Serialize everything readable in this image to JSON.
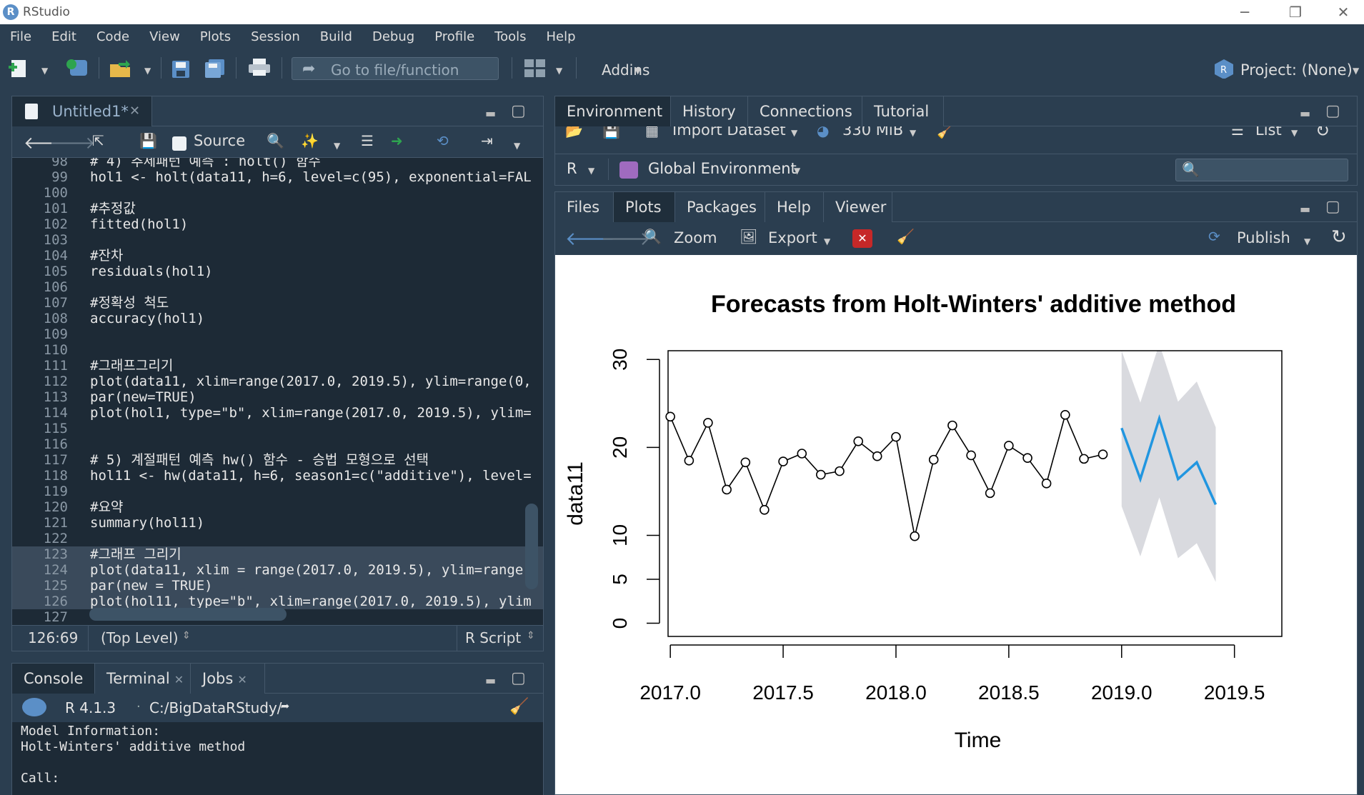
{
  "window": {
    "title": "RStudio"
  },
  "menu": [
    "File",
    "Edit",
    "Code",
    "View",
    "Plots",
    "Session",
    "Build",
    "Debug",
    "Profile",
    "Tools",
    "Help"
  ],
  "toolbar": {
    "goto_placeholder": "Go to file/function",
    "addins": "Addins",
    "project": "Project: (None)"
  },
  "editor": {
    "tab_label": "Untitled1*",
    "source_label": "Source",
    "lines": [
      {
        "n": "98",
        "t": "# 4) 추세패턴 예측 : holt() 함수"
      },
      {
        "n": "99",
        "t": "hol1 <- holt(data11, h=6, level=c(95), exponential=FAL"
      },
      {
        "n": "100",
        "t": ""
      },
      {
        "n": "101",
        "t": "#추정값"
      },
      {
        "n": "102",
        "t": "fitted(hol1)"
      },
      {
        "n": "103",
        "t": ""
      },
      {
        "n": "104",
        "t": "#잔차"
      },
      {
        "n": "105",
        "t": "residuals(hol1)"
      },
      {
        "n": "106",
        "t": ""
      },
      {
        "n": "107",
        "t": "#정확성 척도"
      },
      {
        "n": "108",
        "t": "accuracy(hol1)"
      },
      {
        "n": "109",
        "t": ""
      },
      {
        "n": "110",
        "t": ""
      },
      {
        "n": "111",
        "t": "#그래프그리기"
      },
      {
        "n": "112",
        "t": "plot(data11, xlim=range(2017.0, 2019.5), ylim=range(0,"
      },
      {
        "n": "113",
        "t": "par(new=TRUE)"
      },
      {
        "n": "114",
        "t": "plot(hol1, type=\"b\", xlim=range(2017.0, 2019.5), ylim="
      },
      {
        "n": "115",
        "t": ""
      },
      {
        "n": "116",
        "t": ""
      },
      {
        "n": "117",
        "t": "# 5) 계절패턴 예측 hw() 함수 - 승법 모형으로 선택"
      },
      {
        "n": "118",
        "t": "hol11 <- hw(data11, h=6, season1=c(\"additive\"), level="
      },
      {
        "n": "119",
        "t": ""
      },
      {
        "n": "120",
        "t": "#요약"
      },
      {
        "n": "121",
        "t": "summary(hol11)"
      },
      {
        "n": "122",
        "t": ""
      },
      {
        "n": "123",
        "t": "#그래프 그리기"
      },
      {
        "n": "124",
        "t": "plot(data11, xlim = range(2017.0, 2019.5), ylim=range("
      },
      {
        "n": "125",
        "t": "par(new = TRUE)"
      },
      {
        "n": "126",
        "t": "plot(hol11, type=\"b\", xlim=range(2017.0, 2019.5), ylim"
      },
      {
        "n": "127",
        "t": ""
      }
    ],
    "status_pos": "126:69",
    "status_scope": "(Top Level)",
    "status_type": "R Script"
  },
  "console": {
    "tabs": [
      "Console",
      "Terminal",
      "Jobs"
    ],
    "version": "R 4.1.3",
    "path": "C:/BigDataRStudy/",
    "output": [
      "Model Information:",
      "Holt-Winters' additive method",
      "",
      "Call:"
    ]
  },
  "env": {
    "tabs": [
      "Environment",
      "History",
      "Connections",
      "Tutorial"
    ],
    "import_label": "Import Dataset",
    "memory": "330 MiB",
    "list_label": "List",
    "lang": "R",
    "scope": "Global Environment"
  },
  "plots": {
    "tabs": [
      "Files",
      "Plots",
      "Packages",
      "Help",
      "Viewer"
    ],
    "zoom": "Zoom",
    "export": "Export",
    "publish": "Publish"
  },
  "chart_data": {
    "type": "line",
    "title": "Forecasts from Holt-Winters' additive method",
    "xlabel": "Time",
    "ylabel": "data11",
    "xlim": [
      2016.99,
      2019.71
    ],
    "ylim": [
      -1.5,
      31
    ],
    "xticks": [
      2017.0,
      2017.5,
      2018.0,
      2018.5,
      2019.0,
      2019.5
    ],
    "yticks": [
      0,
      5,
      10,
      20,
      30
    ],
    "series": [
      {
        "x": [
          2017.0,
          2017.083,
          2017.167,
          2017.25,
          2017.333,
          2017.417,
          2017.5,
          2017.583,
          2017.667,
          2017.75,
          2017.833,
          2017.917,
          2018.0,
          2018.083,
          2018.167,
          2018.25,
          2018.333,
          2018.417,
          2018.5,
          2018.583,
          2018.667,
          2018.75,
          2018.833,
          2018.917
        ],
        "y": [
          23.5,
          18.5,
          22.8,
          15.2,
          18.3,
          12.9,
          18.4,
          19.3,
          16.9,
          17.3,
          20.7,
          19.0,
          21.2,
          9.9,
          18.6,
          22.5,
          19.1,
          14.8,
          20.2,
          18.8,
          15.9,
          23.7,
          18.7,
          19.2
        ],
        "color": "#000000"
      }
    ],
    "forecast": {
      "x": [
        2019.0,
        2019.083,
        2019.167,
        2019.25,
        2019.333,
        2019.417
      ],
      "mean": [
        22.2,
        16.4,
        23.3,
        16.4,
        18.3,
        13.5
      ],
      "lower": [
        13.3,
        7.6,
        14.3,
        7.4,
        9.1,
        4.7
      ],
      "upper": [
        31.0,
        25.1,
        31.8,
        25.2,
        27.5,
        22.3
      ],
      "color": "#2196e0",
      "band_color": "#d9dadf"
    }
  }
}
